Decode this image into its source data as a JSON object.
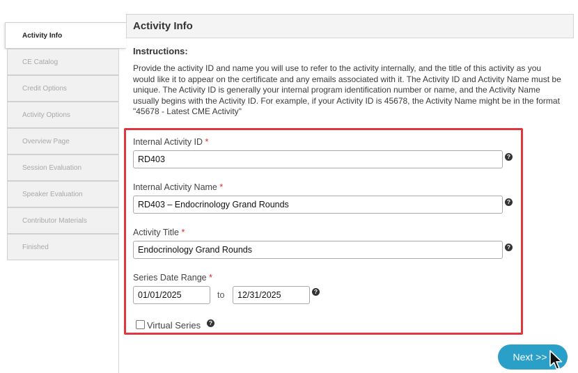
{
  "sidebar": {
    "items": [
      {
        "label": "Activity Info",
        "active": true
      },
      {
        "label": "CE Catalog",
        "active": false
      },
      {
        "label": "Credit Options",
        "active": false
      },
      {
        "label": "Activity Options",
        "active": false
      },
      {
        "label": "Overview Page",
        "active": false
      },
      {
        "label": "Session Evaluation",
        "active": false
      },
      {
        "label": "Speaker Evaluation",
        "active": false
      },
      {
        "label": "Contributor Materials",
        "active": false
      },
      {
        "label": "Finished",
        "active": false
      }
    ]
  },
  "main": {
    "title": "Activity Info",
    "instructions_title": "Instructions:",
    "instructions_text": "Provide the activity ID and name you will use to refer to the activity internally, and the title of this activity as you would like it to appear on the certificate and any emails associated with it. The Activity ID and Activity Name must be unique. The Activity ID is generally your internal program identification number or name, and the Activity Name usually begins with the Activity ID. For example, if your Activity ID is 45678, the Activity Name might be in the format \"45678 - Latest CME Activity\""
  },
  "form": {
    "activity_id": {
      "label": "Internal Activity ID",
      "required": "*",
      "value": "RD403"
    },
    "activity_name": {
      "label": "Internal Activity Name",
      "required": "*",
      "value": "RD403 – Endocrinology Grand Rounds"
    },
    "activity_title": {
      "label": "Activity Title",
      "required": "*",
      "value": "Endocrinology Grand Rounds"
    },
    "series_date_range": {
      "label": "Series Date Range",
      "required": "*",
      "start": "01/01/2025",
      "to_label": "to",
      "end": "12/31/2025"
    },
    "virtual_series": {
      "label": "Virtual Series",
      "checked": false
    },
    "help_glyph": "?"
  },
  "buttons": {
    "next_label": "Next >>"
  },
  "icons": {
    "help": "question-circle-icon",
    "cursor": "mouse-pointer-icon"
  },
  "colors": {
    "highlight_border": "#e0363f",
    "next_button": "#2aa0c8",
    "required": "#d9262e"
  }
}
